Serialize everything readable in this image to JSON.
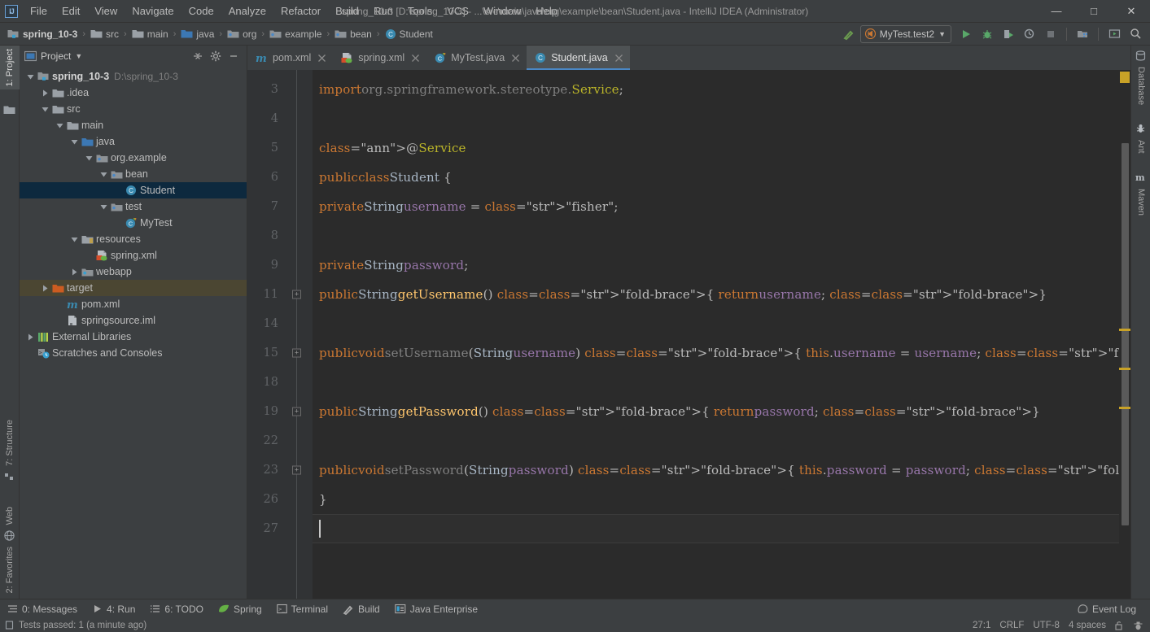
{
  "window": {
    "title": "spring_10-3 [D:\\spring_10-3] - ...\\src\\main\\java\\org\\example\\bean\\Student.java - IntelliJ IDEA (Administrator)",
    "minimize_label": "—",
    "maximize_label": "□",
    "close_label": "✕",
    "logo_text": "IJ"
  },
  "menu": [
    {
      "label": "File"
    },
    {
      "label": "Edit"
    },
    {
      "label": "View"
    },
    {
      "label": "Navigate"
    },
    {
      "label": "Code"
    },
    {
      "label": "Analyze"
    },
    {
      "label": "Refactor"
    },
    {
      "label": "Build"
    },
    {
      "label": "Run"
    },
    {
      "label": "Tools"
    },
    {
      "label": "VCS"
    },
    {
      "label": "Window"
    },
    {
      "label": "Help"
    }
  ],
  "breadcrumbs": [
    {
      "label": "spring_10-3",
      "icon": "module-icon",
      "bold": true
    },
    {
      "label": "src",
      "icon": "folder-icon",
      "bold": false
    },
    {
      "label": "main",
      "icon": "folder-icon",
      "bold": false
    },
    {
      "label": "java",
      "icon": "source-folder-icon",
      "bold": false
    },
    {
      "label": "org",
      "icon": "package-icon",
      "bold": false
    },
    {
      "label": "example",
      "icon": "package-icon",
      "bold": false
    },
    {
      "label": "bean",
      "icon": "package-icon",
      "bold": false
    },
    {
      "label": "Student",
      "icon": "class-icon",
      "bold": false
    }
  ],
  "toolbar": {
    "build_icon": "hammer-icon",
    "run_config": "MyTest.test2",
    "run_config_icon": "junit-run-icon",
    "dropdown_icon": "chevron-down-icon",
    "run_icon": "run-icon",
    "debug_icon": "debug-icon",
    "run_coverage_icon": "run-with-coverage-icon",
    "profile_icon": "profiler-icon",
    "stop_icon": "stop-icon",
    "project_structure_icon": "project-structure-icon",
    "updates_icon": "terminal-window-icon",
    "search_icon": "search-everywhere-icon"
  },
  "left_strip": [
    {
      "label": "1: Project",
      "icon": "project-icon",
      "active": true
    },
    {
      "label": "7: Structure",
      "icon": "structure-icon",
      "active": false
    },
    {
      "label": "Web",
      "icon": "web-icon",
      "active": false
    },
    {
      "label": "2: Favorites",
      "icon": "favorites-star-icon",
      "active": false
    }
  ],
  "right_strip": [
    {
      "label": "Database",
      "icon": "database-icon"
    },
    {
      "label": "Ant",
      "icon": "ant-icon"
    },
    {
      "label": "Maven",
      "icon": "maven-icon"
    }
  ],
  "project_panel": {
    "title": "Project",
    "title_dropdown_icon": "chevron-down-icon",
    "collapse_all_icon": "collapse-all-icon",
    "settings_icon": "gear-icon",
    "hide_icon": "minimize-icon",
    "tree": [
      {
        "label": "spring_10-3",
        "sub": "D:\\spring_10-3",
        "indent": 0,
        "arrow": "down",
        "icon": "project-module-icon",
        "bold": true,
        "state": "normal"
      },
      {
        "label": ".idea",
        "sub": "",
        "indent": 1,
        "arrow": "right",
        "icon": "folder-icon",
        "bold": false,
        "state": "normal"
      },
      {
        "label": "src",
        "sub": "",
        "indent": 1,
        "arrow": "down",
        "icon": "folder-icon",
        "bold": false,
        "state": "normal"
      },
      {
        "label": "main",
        "sub": "",
        "indent": 2,
        "arrow": "down",
        "icon": "folder-icon",
        "bold": false,
        "state": "normal"
      },
      {
        "label": "java",
        "sub": "",
        "indent": 3,
        "arrow": "down",
        "icon": "source-folder-icon",
        "bold": false,
        "state": "normal"
      },
      {
        "label": "org.example",
        "sub": "",
        "indent": 4,
        "arrow": "down",
        "icon": "package-icon",
        "bold": false,
        "state": "normal"
      },
      {
        "label": "bean",
        "sub": "",
        "indent": 5,
        "arrow": "down",
        "icon": "package-icon",
        "bold": false,
        "state": "normal"
      },
      {
        "label": "Student",
        "sub": "",
        "indent": 6,
        "arrow": "none",
        "icon": "class-icon",
        "bold": false,
        "state": "selected"
      },
      {
        "label": "test",
        "sub": "",
        "indent": 5,
        "arrow": "down",
        "icon": "package-icon",
        "bold": false,
        "state": "normal"
      },
      {
        "label": "MyTest",
        "sub": "",
        "indent": 6,
        "arrow": "none",
        "icon": "test-class-icon",
        "bold": false,
        "state": "normal"
      },
      {
        "label": "resources",
        "sub": "",
        "indent": 3,
        "arrow": "down",
        "icon": "resources-folder-icon",
        "bold": false,
        "state": "normal"
      },
      {
        "label": "spring.xml",
        "sub": "",
        "indent": 4,
        "arrow": "none",
        "icon": "spring-xml-icon",
        "bold": false,
        "state": "normal"
      },
      {
        "label": "webapp",
        "sub": "",
        "indent": 3,
        "arrow": "right",
        "icon": "webapp-folder-icon",
        "bold": false,
        "state": "normal"
      },
      {
        "label": "target",
        "sub": "",
        "indent": 1,
        "arrow": "right",
        "icon": "excluded-folder-icon",
        "bold": false,
        "state": "target-hl"
      },
      {
        "label": "pom.xml",
        "sub": "",
        "indent": 2,
        "arrow": "none",
        "icon": "maven-pom-icon",
        "bold": false,
        "state": "normal"
      },
      {
        "label": "springsource.iml",
        "sub": "",
        "indent": 2,
        "arrow": "none",
        "icon": "iml-icon",
        "bold": false,
        "state": "normal"
      },
      {
        "label": "External Libraries",
        "sub": "",
        "indent": 0,
        "arrow": "right",
        "icon": "libraries-icon",
        "bold": false,
        "state": "normal"
      },
      {
        "label": "Scratches and Consoles",
        "sub": "",
        "indent": 0,
        "arrow": "none",
        "icon": "scratches-icon",
        "bold": false,
        "state": "normal"
      }
    ]
  },
  "editor": {
    "tabs": [
      {
        "label": "pom.xml",
        "icon": "maven-pom-icon",
        "active": false,
        "close_icon": "close-icon"
      },
      {
        "label": "spring.xml",
        "icon": "spring-xml-icon",
        "active": false,
        "close_icon": "close-icon"
      },
      {
        "label": "MyTest.java",
        "icon": "test-class-icon",
        "active": false,
        "close_icon": "close-icon"
      },
      {
        "label": "Student.java",
        "icon": "class-icon",
        "active": true,
        "close_icon": "close-icon"
      }
    ],
    "lines": [
      {
        "num": "3",
        "fold": false,
        "caret": false
      },
      {
        "num": "4",
        "fold": false,
        "caret": false
      },
      {
        "num": "5",
        "fold": false,
        "caret": false
      },
      {
        "num": "6",
        "fold": false,
        "caret": false
      },
      {
        "num": "7",
        "fold": false,
        "caret": false
      },
      {
        "num": "8",
        "fold": false,
        "caret": false
      },
      {
        "num": "9",
        "fold": false,
        "caret": false
      },
      {
        "num": "11",
        "fold": true,
        "caret": false
      },
      {
        "num": "14",
        "fold": false,
        "caret": false
      },
      {
        "num": "15",
        "fold": true,
        "caret": false
      },
      {
        "num": "18",
        "fold": false,
        "caret": false
      },
      {
        "num": "19",
        "fold": true,
        "caret": false
      },
      {
        "num": "22",
        "fold": false,
        "caret": false
      },
      {
        "num": "23",
        "fold": true,
        "caret": false
      },
      {
        "num": "26",
        "fold": false,
        "caret": false
      },
      {
        "num": "27",
        "fold": false,
        "caret": true
      }
    ],
    "code_text": [
      "import org.springframework.stereotype.Service;",
      "",
      "@Service",
      "public class Student {",
      "    private String username = \"fisher\";",
      "",
      "    private String password;",
      "    public String getUsername() { return username; }",
      "",
      "    public void setUsername(String username) { this.username = username; }",
      "",
      "    public String getPassword() { return password; }",
      "",
      "    public void setPassword(String password) { this.password = password; }",
      "}",
      ""
    ]
  },
  "bottom_tools": [
    {
      "label": "0: Messages",
      "icon": "messages-icon"
    },
    {
      "label": "4: Run",
      "icon": "run-icon"
    },
    {
      "label": "6: TODO",
      "icon": "todo-icon"
    },
    {
      "label": "Spring",
      "icon": "spring-leaf-icon"
    },
    {
      "label": "Terminal",
      "icon": "terminal-icon"
    },
    {
      "label": "Build",
      "icon": "hammer-icon"
    },
    {
      "label": "Java Enterprise",
      "icon": "java-enterprise-icon"
    }
  ],
  "event_log": {
    "label": "Event Log",
    "icon": "event-log-icon"
  },
  "statusbar": {
    "message": "Tests passed: 1 (a minute ago)",
    "message_icon": "test-status-icon",
    "caret_position": "27:1",
    "line_separator": "CRLF",
    "encoding": "UTF-8",
    "indent": "4 spaces",
    "lock_icon": "unlocked-icon",
    "inspector_icon": "hector-icon"
  },
  "colors": {
    "bg_chrome": "#3c3f41",
    "bg_editor": "#2b2b2b",
    "accent_blue": "#4a88c7",
    "selection": "#0d293e",
    "keyword": "#cc7832",
    "string": "#6a8759",
    "field": "#9876aa",
    "annotation": "#bbb529",
    "method": "#ffc66d",
    "warning_marker": "#c9a227"
  }
}
